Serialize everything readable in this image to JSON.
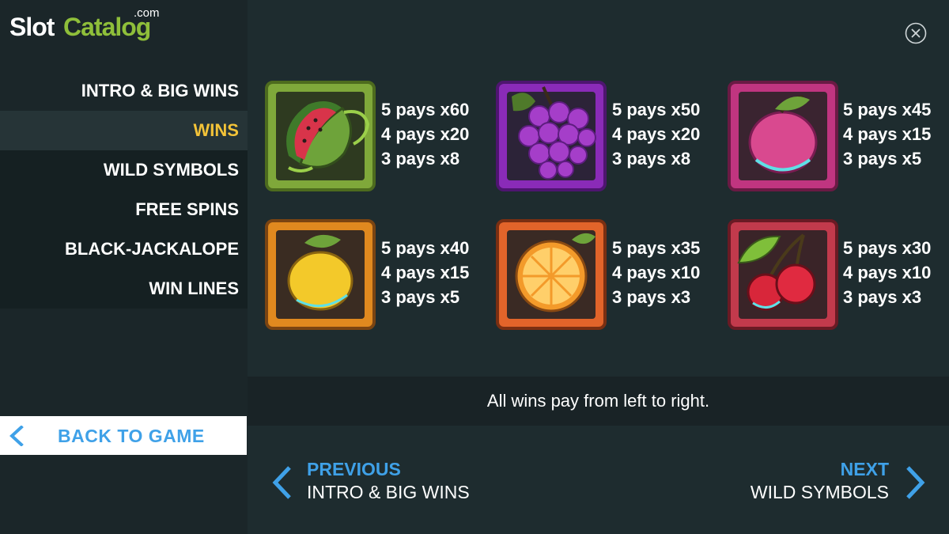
{
  "logo": {
    "slot": "Slot",
    "catalog": "Catalog",
    "com": ".com"
  },
  "nav": [
    {
      "label": "INTRO & BIG WINS",
      "active": false
    },
    {
      "label": "WINS",
      "active": true
    },
    {
      "label": "WILD SYMBOLS",
      "active": false
    },
    {
      "label": "FREE SPINS",
      "active": false
    },
    {
      "label": "BLACK-JACKALOPE",
      "active": false
    },
    {
      "label": "WIN LINES",
      "active": false
    }
  ],
  "back": {
    "label": "BACK TO GAME",
    "icon": "chevron-left-icon"
  },
  "close": {
    "icon": "close-icon"
  },
  "symbols": [
    {
      "name": "watermelon",
      "pays": [
        "5 pays x60",
        "4 pays x20",
        "3 pays x8"
      ]
    },
    {
      "name": "grapes",
      "pays": [
        "5 pays x50",
        "4 pays x20",
        "3 pays x8"
      ]
    },
    {
      "name": "plum",
      "pays": [
        "5 pays x45",
        "4 pays x15",
        "3 pays x5"
      ]
    },
    {
      "name": "lemon",
      "pays": [
        "5 pays x40",
        "4 pays x15",
        "3 pays x5"
      ]
    },
    {
      "name": "orange",
      "pays": [
        "5 pays x35",
        "4 pays x10",
        "3 pays x3"
      ]
    },
    {
      "name": "cherries",
      "pays": [
        "5 pays x30",
        "4 pays x10",
        "3 pays x3"
      ]
    }
  ],
  "note": "All wins pay from left to right.",
  "previous": {
    "label": "PREVIOUS",
    "target": "INTRO & BIG WINS"
  },
  "next": {
    "label": "NEXT",
    "target": "WILD SYMBOLS"
  },
  "colors": {
    "accent_blue": "#3fa1e8",
    "active_yellow": "#f3c338",
    "logo_green": "#8fbf3a",
    "background": "#1e2c2f"
  }
}
